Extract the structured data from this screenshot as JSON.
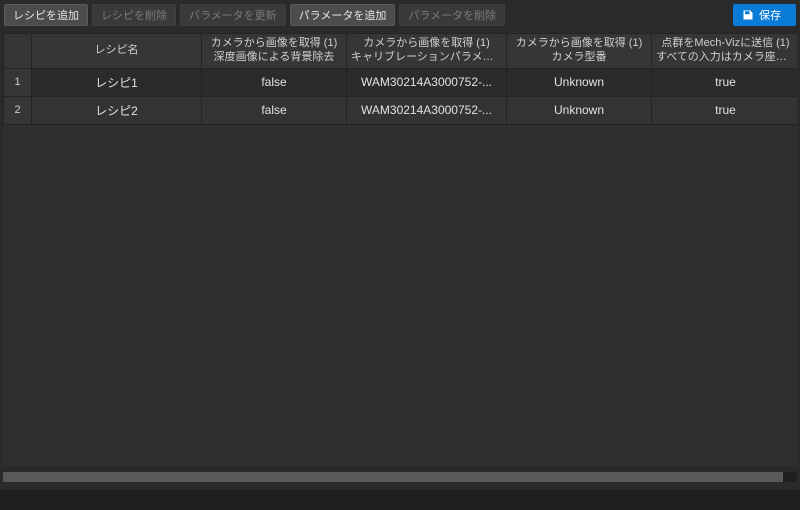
{
  "toolbar": {
    "add_recipe": "レシピを追加",
    "delete_recipe": "レシピを削除",
    "update_param": "パラメータを更新",
    "add_param": "パラメータを追加",
    "delete_param": "パラメータを削除",
    "save": "保存"
  },
  "table": {
    "headers": {
      "idx": "",
      "name": "レシピ名",
      "col2_l1": "カメラから画像を取得 (1)",
      "col2_l2": "深度画像による背景除去",
      "col3_l1": "カメラから画像を取得 (1)",
      "col3_l2": "キャリブレーションパラメータグループ",
      "col4_l1": "カメラから画像を取得 (1)",
      "col4_l2": "カメラ型番",
      "col5_l1": "点群をMech-Vizに送信 (1)",
      "col5_l2": "すべての入力はカメラ座標系にある"
    },
    "rows": [
      {
        "idx": "1",
        "name": "レシピ1",
        "c2": "false",
        "c3": "WAM30214A3000752-...",
        "c4": "Unknown",
        "c5": "true"
      },
      {
        "idx": "2",
        "name": "レシピ2",
        "c2": "false",
        "c3": "WAM30214A3000752-...",
        "c4": "Unknown",
        "c5": "true"
      }
    ]
  }
}
